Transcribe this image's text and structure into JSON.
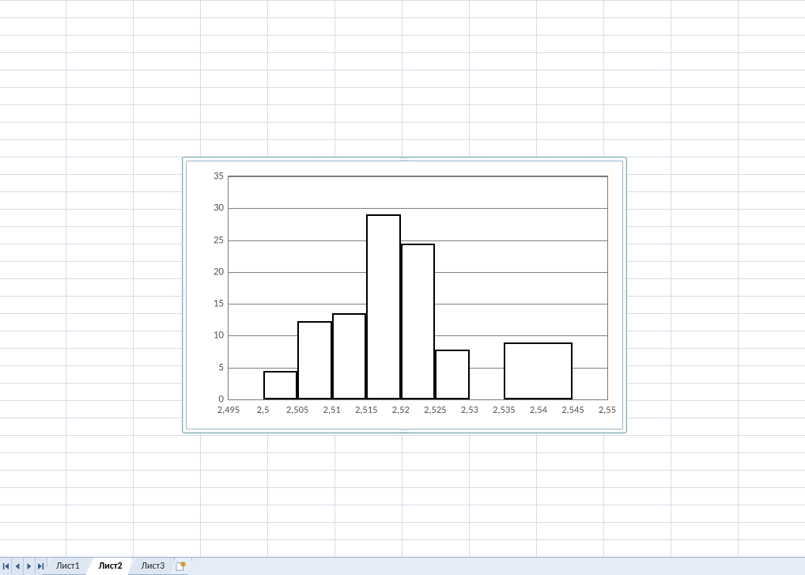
{
  "tabs": {
    "items": [
      {
        "label": "Лист1",
        "active": false
      },
      {
        "label": "Лист2",
        "active": true
      },
      {
        "label": "Лист3",
        "active": false
      }
    ]
  },
  "chart_data": {
    "type": "bar",
    "title": "",
    "xlabel": "",
    "ylabel": "",
    "xlim": [
      2.495,
      2.55
    ],
    "ylim": [
      0,
      35
    ],
    "x_tick_step": 0.005,
    "y_tick_step": 5,
    "x_tick_labels": [
      "2,495",
      "2,5",
      "2,505",
      "2,51",
      "2,515",
      "2,52",
      "2,525",
      "2,53",
      "2,535",
      "2,54",
      "2,545",
      "2,55"
    ],
    "y_tick_labels": [
      "0",
      "5",
      "10",
      "15",
      "20",
      "25",
      "30",
      "35"
    ],
    "bars": [
      {
        "x0": 2.5,
        "x1": 2.505,
        "value": 4.5
      },
      {
        "x0": 2.505,
        "x1": 2.51,
        "value": 12.3
      },
      {
        "x0": 2.51,
        "x1": 2.515,
        "value": 13.5
      },
      {
        "x0": 2.515,
        "x1": 2.52,
        "value": 29.0
      },
      {
        "x0": 2.52,
        "x1": 2.525,
        "value": 24.5
      },
      {
        "x0": 2.525,
        "x1": 2.53,
        "value": 7.8
      },
      {
        "x0": 2.535,
        "x1": 2.545,
        "value": 9.0
      }
    ]
  }
}
